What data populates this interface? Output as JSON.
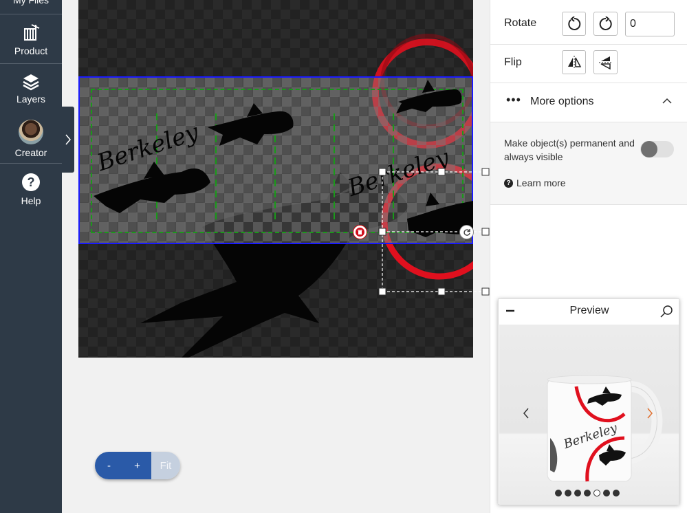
{
  "sidebar": {
    "items": [
      {
        "label": "My Files",
        "icon": "folder-icon"
      },
      {
        "label": "Product",
        "icon": "product-icon"
      },
      {
        "label": "Layers",
        "icon": "layers-icon"
      },
      {
        "label": "Creator",
        "icon": "avatar"
      },
      {
        "label": "Help",
        "icon": "help-icon"
      }
    ]
  },
  "canvas": {
    "text_items": [
      "Berkeley",
      "Berkeley"
    ],
    "colors": {
      "print_area_border": "#1a1aff",
      "safe_area_border": "#1a9a1a",
      "circle": "#e0101e"
    }
  },
  "zoom": {
    "minus": "-",
    "plus": "+",
    "fit": "Fit"
  },
  "panel": {
    "rotate_label": "Rotate",
    "rotate_value": "0",
    "flip_label": "Flip",
    "more_options": "More options",
    "permanent_text": "Make object(s) permanent and always visible",
    "learn_more": "Learn more"
  },
  "preview": {
    "title": "Preview",
    "mug_text": "Berkeley",
    "dots": 7,
    "active_dot": 5
  }
}
